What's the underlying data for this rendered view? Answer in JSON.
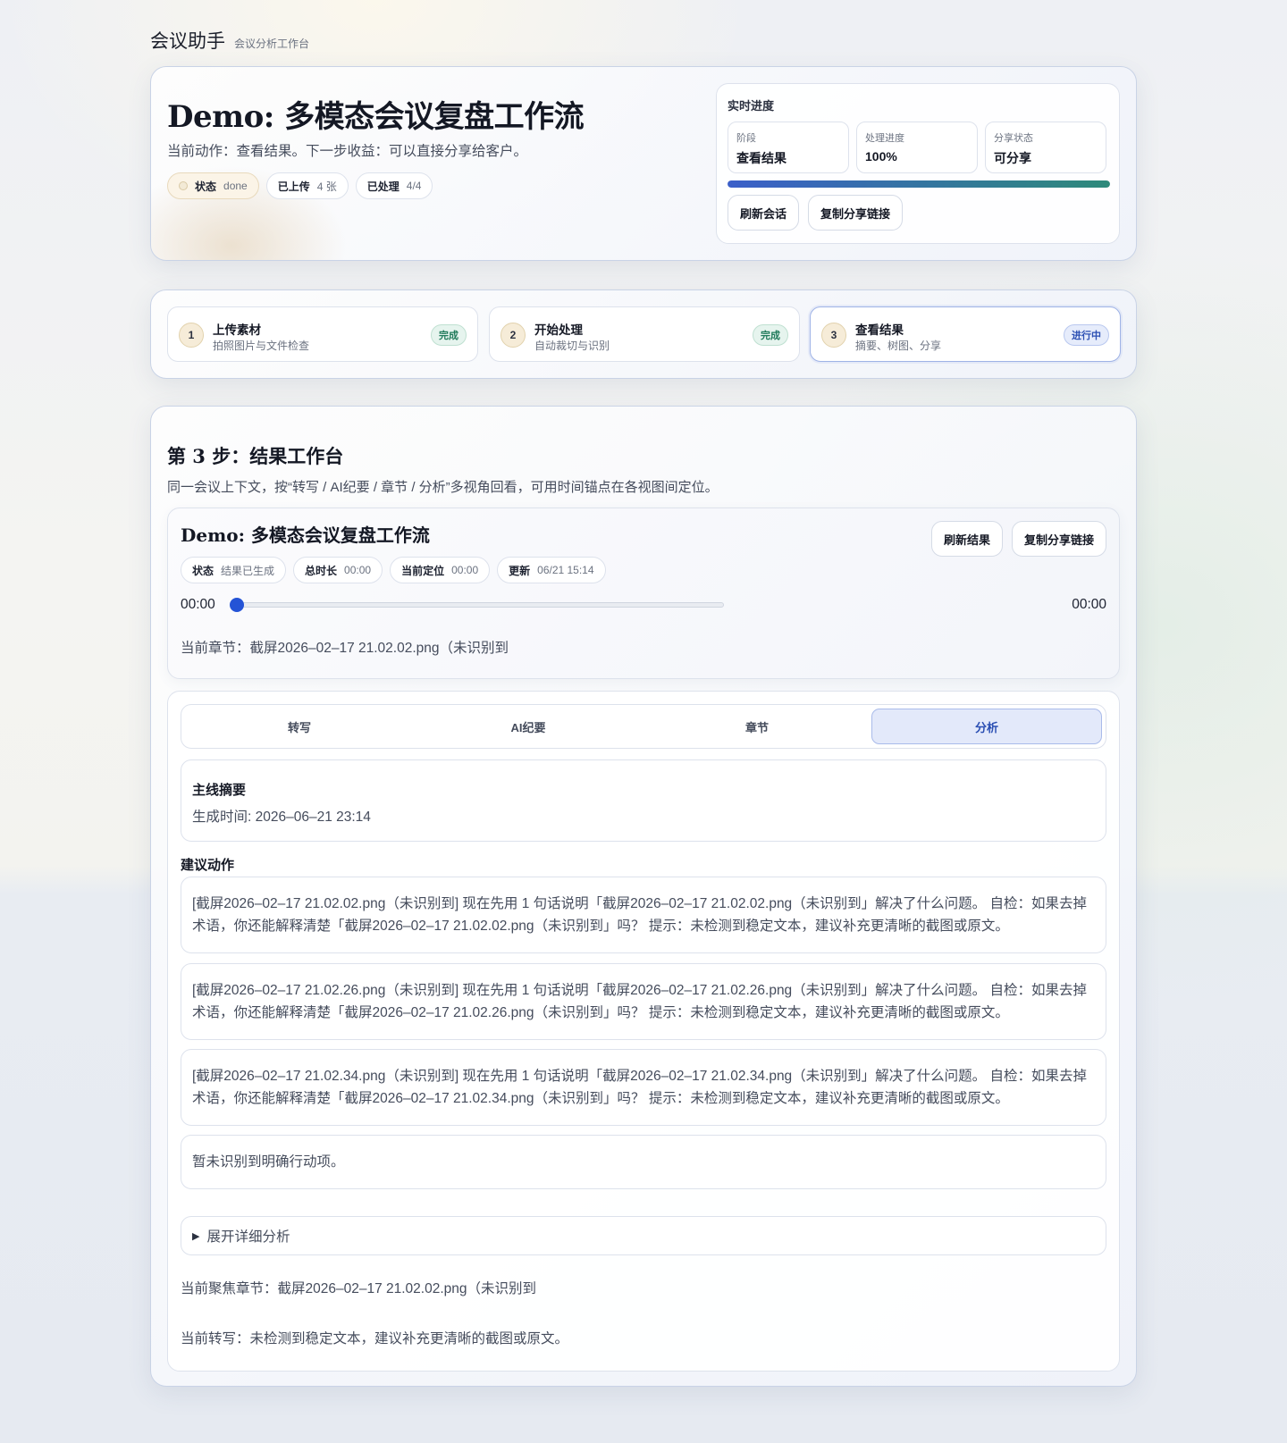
{
  "brand": {
    "title": "会议助手",
    "subtitle": "会议分析工作台"
  },
  "hero": {
    "title": "Demo: 多模态会议复盘工作流",
    "desc": "当前动作：查看结果。下一步收益：可以直接分享给客户。",
    "chips": [
      {
        "key": "状态",
        "value": "done"
      },
      {
        "key": "已上传",
        "value": "4 张"
      },
      {
        "key": "已处理",
        "value": "4/4"
      }
    ]
  },
  "progress": {
    "title": "实时进度",
    "cells": [
      {
        "key": "阶段",
        "value": "查看结果"
      },
      {
        "key": "处理进度",
        "value": "100%"
      },
      {
        "key": "分享状态",
        "value": "可分享"
      }
    ],
    "fill_fraction": 1.0,
    "buttons": {
      "refresh": "刷新会话",
      "copy": "复制分享链接"
    }
  },
  "steps": [
    {
      "num": "1",
      "title": "上传素材",
      "sub": "拍照图片与文件检查",
      "badge": "完成"
    },
    {
      "num": "2",
      "title": "开始处理",
      "sub": "自动裁切与识别",
      "badge": "完成"
    },
    {
      "num": "3",
      "title": "查看结果",
      "sub": "摘要、树图、分享",
      "badge": "进行中"
    }
  ],
  "main": {
    "title": "第 3 步：结果工作台",
    "desc": "同一会议上下文，按“转写 / AI纪要 / 章节 / 分析”多视角回看，可用时间锚点在各视图间定位。"
  },
  "player": {
    "title": "Demo: 多模态会议复盘工作流",
    "buttons": {
      "refresh": "刷新结果",
      "copy": "复制分享链接"
    },
    "chips": [
      {
        "key": "状态",
        "value": "结果已生成"
      },
      {
        "key": "总时长",
        "value": "00:00"
      },
      {
        "key": "当前定位",
        "value": "00:00"
      },
      {
        "key": "更新",
        "value": "06/21 15:14"
      }
    ],
    "time_current": "00:00",
    "time_total": "00:00",
    "position_fraction": 0,
    "current_chapter": "当前章节：截屏2026–02–17 21.02.02.png（未识别到"
  },
  "tabs": [
    "转写",
    "AI纪要",
    "章节",
    "分析"
  ],
  "active_tab": 3,
  "summary": {
    "heading": "主线摘要",
    "meta": "生成时间: 2026–06–21 23:14"
  },
  "actions": {
    "heading": "建议动作",
    "items": [
      "[截屏2026–02–17 21.02.02.png（未识别到] 现在先用 1 句话说明「截屏2026–02–17 21.02.02.png（未识别到」解决了什么问题。 自检：如果去掉术语，你还能解释清楚「截屏2026–02–17 21.02.02.png（未识别到」吗？ 提示：未检测到稳定文本，建议补充更清晰的截图或原文。",
      "[截屏2026–02–17 21.02.26.png（未识别到] 现在先用 1 句话说明「截屏2026–02–17 21.02.26.png（未识别到」解决了什么问题。 自检：如果去掉术语，你还能解释清楚「截屏2026–02–17 21.02.26.png（未识别到」吗？ 提示：未检测到稳定文本，建议补充更清晰的截图或原文。",
      "[截屏2026–02–17 21.02.34.png（未识别到] 现在先用 1 句话说明「截屏2026–02–17 21.02.34.png（未识别到」解决了什么问题。 自检：如果去掉术语，你还能解释清楚「截屏2026–02–17 21.02.34.png（未识别到」吗？ 提示：未检测到稳定文本，建议补充更清晰的截图或原文。"
    ],
    "empty": "暂未识别到明确行动项。"
  },
  "details_toggle": "展开详细分析",
  "footer": {
    "focus_chapter": "当前聚焦章节：截屏2026–02–17 21.02.02.png（未识别到",
    "transcript": "当前转写：未检测到稳定文本，建议补充更清晰的截图或原文。"
  },
  "colors": {
    "accent": "#2453d6",
    "done_badge": "#1f7a5a",
    "progress_badge": "#2b4fb3"
  },
  "icons": {
    "status_dot": "status-dot-icon",
    "details_toggle": "triangle-right-icon"
  }
}
